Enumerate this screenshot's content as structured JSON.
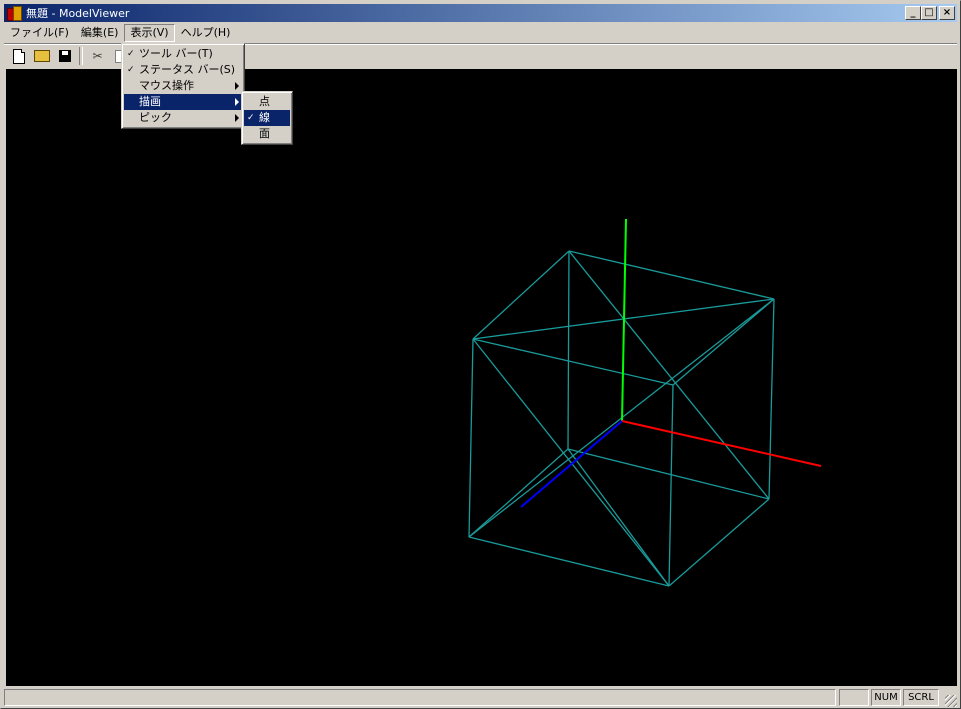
{
  "window": {
    "title": "無題 - ModelViewer",
    "minimize": "_",
    "maximize": "□",
    "close": "×"
  },
  "menubar": {
    "items": [
      {
        "label": "ファイル(F)"
      },
      {
        "label": "編集(E)"
      },
      {
        "label": "表示(V)"
      },
      {
        "label": "ヘルプ(H)"
      }
    ]
  },
  "toolbar": {
    "buttons": [
      "new-icon",
      "open-folder-icon",
      "save-icon",
      "cut-icon",
      "copy-icon"
    ],
    "cut_glyph": "✂"
  },
  "view_menu": {
    "items": [
      {
        "label": "ツール バー(T)",
        "check": "✓"
      },
      {
        "label": "ステータス バー(S)",
        "check": "✓"
      },
      {
        "label": "マウス操作",
        "submenu": true
      },
      {
        "label": "描画",
        "submenu": true,
        "highlighted": true
      },
      {
        "label": "ピック",
        "submenu": true
      }
    ]
  },
  "draw_submenu": {
    "items": [
      {
        "label": "点"
      },
      {
        "label": "線",
        "check": "✓",
        "highlighted": true
      },
      {
        "label": "面"
      }
    ]
  },
  "statusbar": {
    "message": "",
    "indicator_blank": "",
    "num": "NUM",
    "scrl": "SCRL"
  },
  "scene": {
    "background": "#000000",
    "wireframe_color": "#1a9a9a",
    "axis_x_color": "#ff0000",
    "axis_y_color": "#00ff00",
    "axis_z_color": "#0000ff"
  }
}
